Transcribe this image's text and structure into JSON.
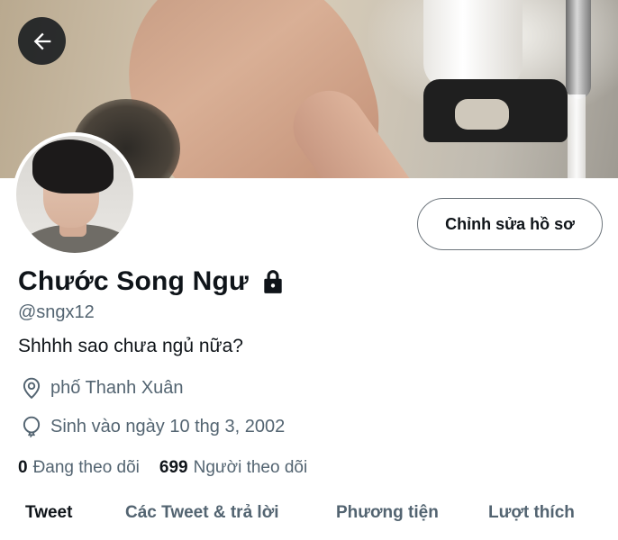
{
  "profile": {
    "display_name": "Chước Song Ngư",
    "handle": "@sngx12",
    "bio": "Shhhh sao chưa ngủ nữa?",
    "location": "phố Thanh Xuân",
    "birthday": "Sinh vào ngày 10 thg 3, 2002",
    "following_count": "0",
    "following_label": "Đang theo dõi",
    "followers_count": "699",
    "followers_label": "Người theo dõi",
    "protected": true
  },
  "actions": {
    "edit_profile_label": "Chỉnh sửa hồ sơ"
  },
  "tabs": [
    {
      "label": "Tweet",
      "active": true
    },
    {
      "label": "Các Tweet & trả lời",
      "active": false
    },
    {
      "label": "Phương tiện",
      "active": false
    },
    {
      "label": "Lượt thích",
      "active": false
    }
  ],
  "icons": {
    "back": "arrow-left-icon",
    "lock": "lock-icon",
    "location": "location-pin-icon",
    "birthday": "balloon-icon"
  },
  "colors": {
    "primary_text": "#0f1419",
    "secondary_text": "#536471",
    "back_button_bg": "#0f1419"
  }
}
